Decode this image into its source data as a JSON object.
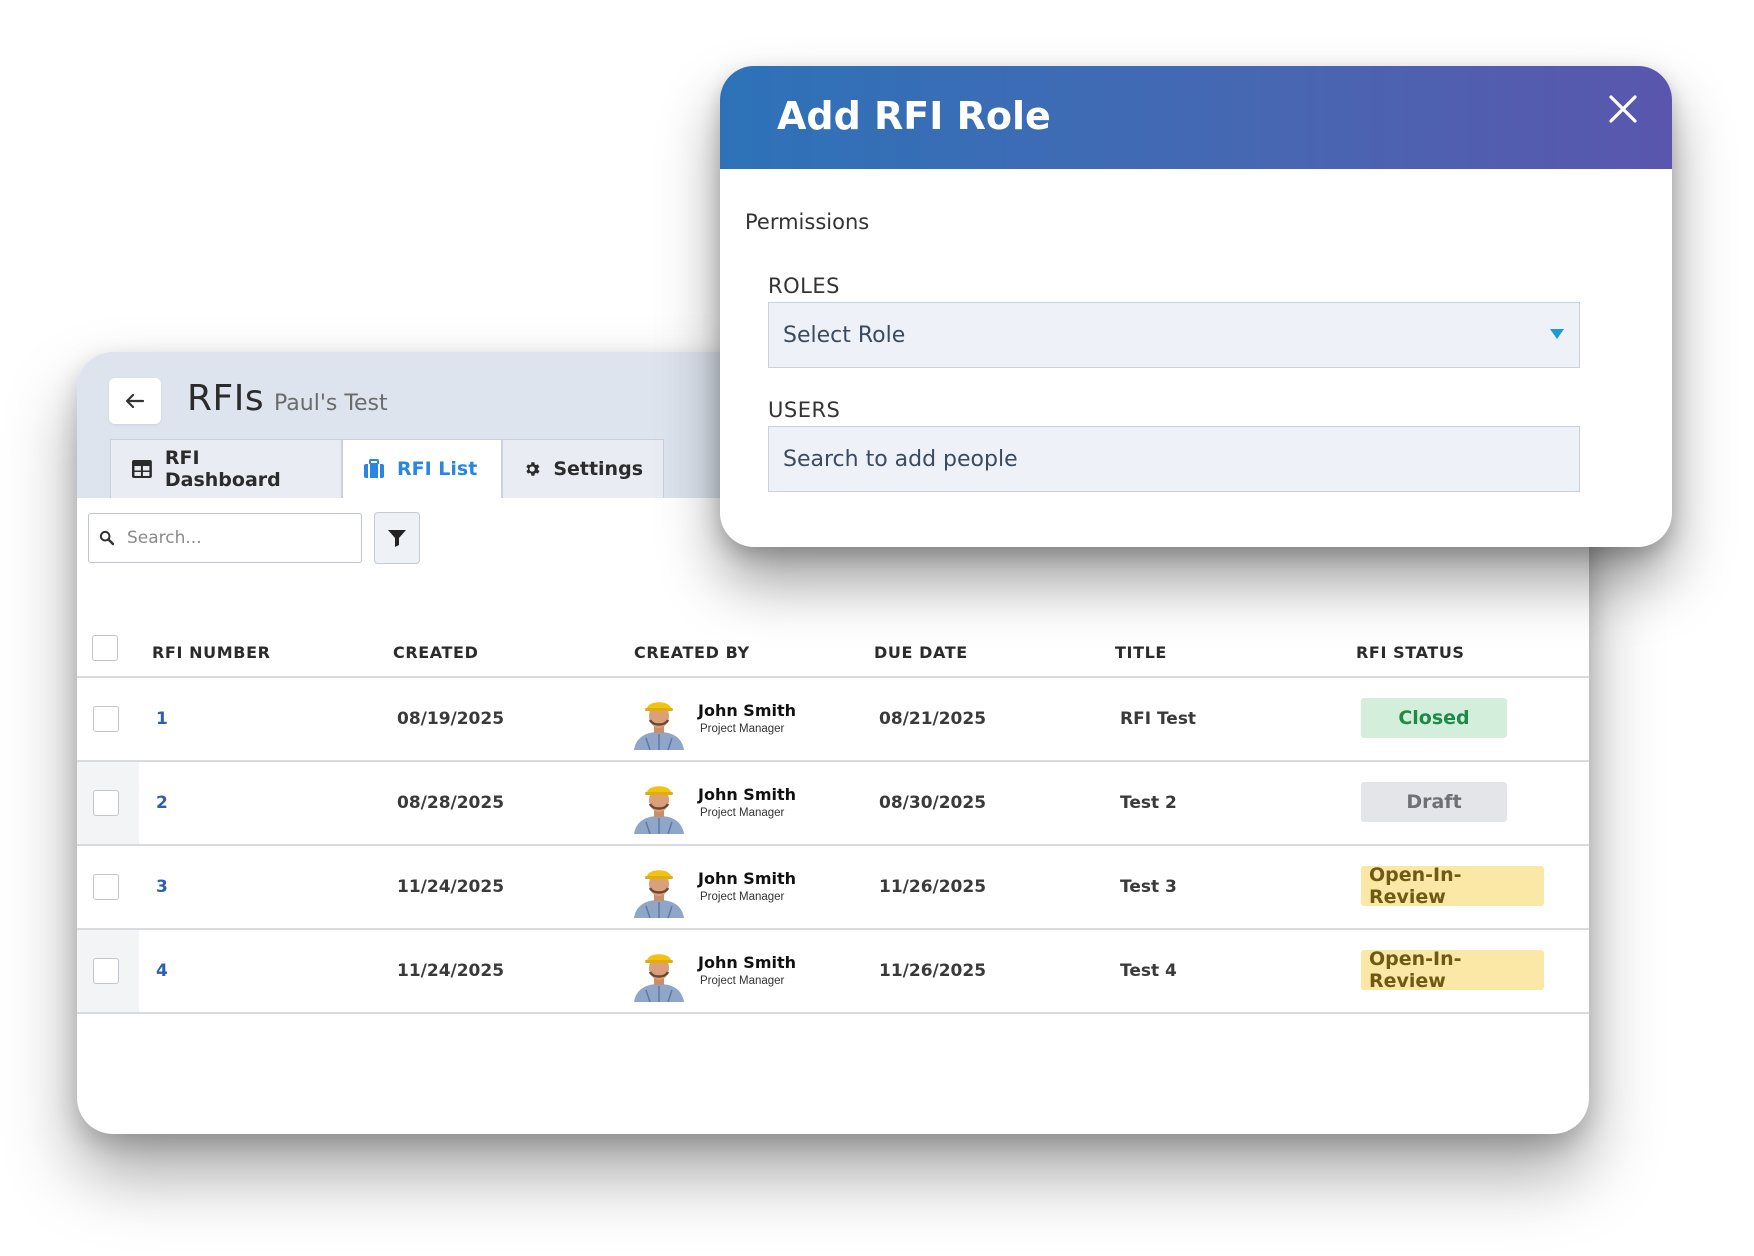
{
  "rfi_page": {
    "back_icon": "arrow-left-icon",
    "title": "RFIs",
    "subtitle": "Paul's Test",
    "tabs": [
      {
        "label": "RFI Dashboard",
        "icon": "table-icon",
        "active": false
      },
      {
        "label": "RFI List",
        "icon": "briefcase-icon",
        "active": true
      },
      {
        "label": "Settings",
        "icon": "gear-icon",
        "active": false
      }
    ],
    "search": {
      "placeholder": "Search...",
      "icon": "search-icon"
    },
    "filter_icon": "filter-icon",
    "table": {
      "columns": [
        "RFI NUMBER",
        "CREATED",
        "CREATED BY",
        "DUE DATE",
        "TITLE",
        "RFI STATUS"
      ],
      "rows": [
        {
          "number": "1",
          "created": "08/19/2025",
          "created_by": {
            "name": "John Smith",
            "role": "Project Manager"
          },
          "due_date": "08/21/2025",
          "title": "RFI Test",
          "status": "Closed"
        },
        {
          "number": "2",
          "created": "08/28/2025",
          "created_by": {
            "name": "John Smith",
            "role": "Project Manager"
          },
          "due_date": "08/30/2025",
          "title": "Test 2",
          "status": "Draft"
        },
        {
          "number": "3",
          "created": "11/24/2025",
          "created_by": {
            "name": "John Smith",
            "role": "Project Manager"
          },
          "due_date": "11/26/2025",
          "title": "Test 3",
          "status": "Open-In-Review"
        },
        {
          "number": "4",
          "created": "11/24/2025",
          "created_by": {
            "name": "John Smith",
            "role": "Project Manager"
          },
          "due_date": "11/26/2025",
          "title": "Test 4",
          "status": "Open-In-Review"
        }
      ]
    },
    "status_colors": {
      "Closed": {
        "bg": "#d3efdc",
        "fg": "#1f8a46"
      },
      "Draft": {
        "bg": "#e3e5e8",
        "fg": "#6d7075"
      },
      "Open-In-Review": {
        "bg": "#fbe8a6",
        "fg": "#6e5a13"
      }
    }
  },
  "modal": {
    "title": "Add RFI Role",
    "close_icon": "close-icon",
    "section_label": "Permissions",
    "roles": {
      "label": "ROLES",
      "placeholder": "Select Role",
      "icon": "caret-down-icon"
    },
    "users": {
      "label": "USERS",
      "placeholder": "Search to add people"
    },
    "header_gradient": [
      "#2d72b8",
      "#5a56ad"
    ]
  }
}
